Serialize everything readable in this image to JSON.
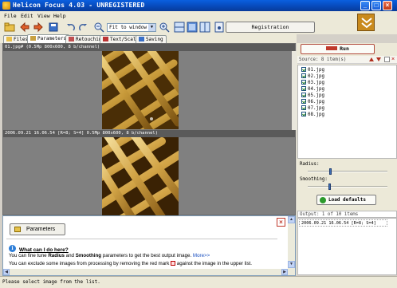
{
  "window": {
    "title": "Helicon Focus 4.03 - UNREGISTERED",
    "min": "_",
    "max": "□",
    "close": "×"
  },
  "menu": [
    "File",
    "Edit",
    "View",
    "Help"
  ],
  "toolbar": {
    "zoom_value": "Fit to window",
    "register_label": "Registration",
    "icons": [
      "open-folder-icon",
      "back-arrow-icon",
      "forward-arrow-icon",
      "save-icon",
      "undo-icon",
      "redo-icon",
      "zoom-in-icon",
      "zoom-out-icon",
      "view-split-icon",
      "view-single-icon",
      "view-compare-icon",
      "pan-icon"
    ]
  },
  "tabs": [
    "Files",
    "Parameters",
    "Retouching",
    "Text/Scale",
    "Saving"
  ],
  "active_tab": "Parameters",
  "viewer": {
    "top_header": "01.jpg# (0.5Mp 800x600, 8 b/channel)",
    "bottom_header": "2006.09.21 16.06.54 [R=8; S=4] 0.5Mp 800x600, 8 b/channel)"
  },
  "help": {
    "button_label": "Parameters",
    "title": "What can I do here?",
    "line1_pre": "You can fine tune ",
    "line1_b1": "Radius",
    "line1_mid": " and ",
    "line1_b2": "Smoothing",
    "line1_post": " parameters to get the best output image. ",
    "line1_link": "More>>",
    "line2_pre": "You can exclude some images from processing by removing  the red mark ",
    "line2_post": " against the image in the upper list."
  },
  "right": {
    "run_label": "Run",
    "source_header": "Source: 8 item(s)",
    "sources": [
      "01.jpg",
      "02.jpg",
      "03.jpg",
      "04.jpg",
      "05.jpg",
      "06.jpg",
      "07.jpg",
      "08.jpg"
    ],
    "radius_label": "Radius:",
    "radius_value": 8,
    "smoothing_label": "Smoothing:",
    "smoothing_value": 4,
    "load_defaults": "Load defaults",
    "output_header": "Output: 1 of 10 items",
    "output_items": [
      "2006.09.21 16.06.54 [R=8; S=4]"
    ]
  },
  "status": "Please select image from the list.",
  "colors": {
    "title_blue": "#0748b8",
    "run_border": "#b24a3b",
    "check_green": "#1a7a1a",
    "link_blue": "#1a4fc0"
  }
}
